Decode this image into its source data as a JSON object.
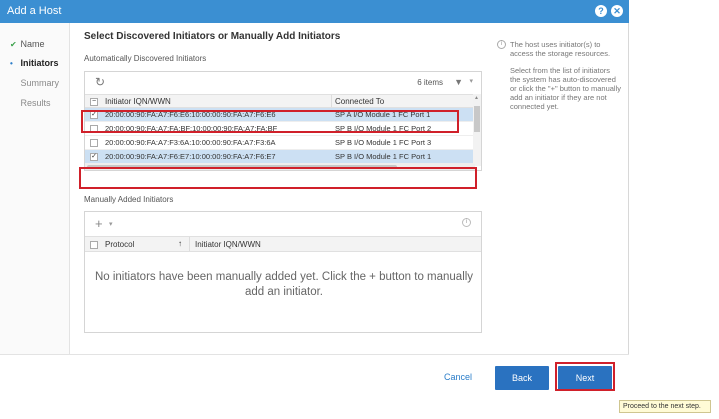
{
  "window": {
    "title": "Add a Host"
  },
  "steps": [
    {
      "label": "Name",
      "state": "done"
    },
    {
      "label": "Initiators",
      "state": "active"
    },
    {
      "label": "Summary",
      "state": "pending"
    },
    {
      "label": "Results",
      "state": "pending"
    }
  ],
  "main": {
    "heading": "Select Discovered Initiators or Manually Add Initiators",
    "auto_label": "Automatically Discovered Initiators",
    "items_count": "6 items",
    "columns": [
      "Initiator IQN/WWN",
      "Connected To"
    ],
    "rows": [
      {
        "iqn": "20:00:00:90:FA:A7:F6:E6:10:00:00:90:FA:A7:F6:E6",
        "connected": "SP A I/O Module 1 FC Port 1",
        "checked": true
      },
      {
        "iqn": "20:00:00:90:FA:A7:FA:BF:10:00:00:90:FA:A7:FA:BF",
        "connected": "SP B I/O Module 1 FC Port 2",
        "checked": false
      },
      {
        "iqn": "20:00:00:90:FA:A7:F3:6A:10:00:00:90:FA:A7:F3:6A",
        "connected": "SP B I/O Module 1 FC Port 3",
        "checked": false
      },
      {
        "iqn": "20:00:00:90:FA:A7:F6:E7:10:00:00:90:FA:A7:F6:E7",
        "connected": "SP B I/O Module 1 FC Port 1",
        "checked": true
      }
    ],
    "manual_label": "Manually Added Initiators",
    "manual_columns": [
      "Protocol",
      "Initiator IQN/WWN"
    ],
    "manual_sort_arrow": "↑",
    "empty_message": "No initiators have been manually added yet. Click the + button to manually add an initiator."
  },
  "side": {
    "p1": "The host uses initiator(s) to access the storage resources.",
    "p2": "Select from the list of initiators the system has auto-discovered or click the \"+\" button to manually add an initiator if they are not connected yet."
  },
  "footer": {
    "cancel": "Cancel",
    "back": "Back",
    "next": "Next"
  },
  "tooltip": "Proceed to the next step.",
  "colors": {
    "accent": "#2a72c0",
    "titlebar": "#3b8fd2",
    "highlight": "#d0202a",
    "selected_row": "#cce0f3"
  },
  "icons": {
    "help": "help-icon",
    "close": "close-icon",
    "refresh": "refresh-icon",
    "filter": "filter-icon",
    "add": "plus-icon",
    "info": "info-icon"
  }
}
